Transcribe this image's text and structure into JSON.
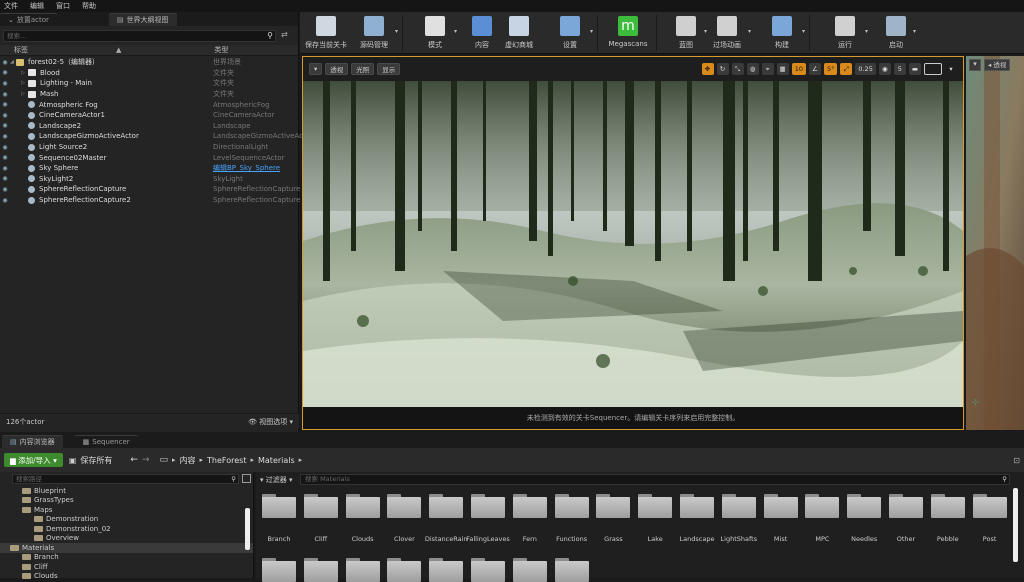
{
  "menu": [
    "文件",
    "编辑",
    "窗口",
    "帮助"
  ],
  "outliner": {
    "tab_place": "放置actor",
    "tab_outliner": "世界大纲视图",
    "search_placeholder": "搜索...",
    "col_label": "标签",
    "col_type": "类型",
    "rows": [
      {
        "label": "forest02-5（编辑器）",
        "type": "世界场景",
        "level": 0,
        "kind": "world"
      },
      {
        "label": "Blood",
        "type": "文件夹",
        "level": 1,
        "kind": "folder"
      },
      {
        "label": "Lighting - Main",
        "type": "文件夹",
        "level": 1,
        "kind": "folder"
      },
      {
        "label": "Mash",
        "type": "文件夹",
        "level": 1,
        "kind": "folder"
      },
      {
        "label": "Atmospheric Fog",
        "type": "AtmosphericFog",
        "level": 1,
        "kind": "actor"
      },
      {
        "label": "CineCameraActor1",
        "type": "CineCameraActor",
        "level": 1,
        "kind": "actor"
      },
      {
        "label": "Landscape2",
        "type": "Landscape",
        "level": 1,
        "kind": "actor"
      },
      {
        "label": "LandscapeGizmoActiveActor",
        "type": "LandscapeGizmoActiveAc",
        "level": 1,
        "kind": "actor"
      },
      {
        "label": "Light Source2",
        "type": "DirectionalLight",
        "level": 1,
        "kind": "actor"
      },
      {
        "label": "Sequence02Master",
        "type": "LevelSequenceActor",
        "level": 1,
        "kind": "actor"
      },
      {
        "label": "Sky Sphere",
        "type": "编辑BP_Sky_Sphere",
        "level": 1,
        "kind": "actor",
        "link": true
      },
      {
        "label": "SkyLight2",
        "type": "SkyLight",
        "level": 1,
        "kind": "actor"
      },
      {
        "label": "SphereReflectionCapture",
        "type": "SphereReflectionCapture",
        "level": 1,
        "kind": "actor"
      },
      {
        "label": "SphereReflectionCapture2",
        "type": "SphereReflectionCapture",
        "level": 1,
        "kind": "actor"
      }
    ],
    "count": "126个actor",
    "view_options": "视图选项"
  },
  "toolbar": [
    {
      "label": "保存当前关卡",
      "icon": "save-icon",
      "color": "#cfd8e0"
    },
    {
      "label": "源码管理",
      "icon": "source-control-icon",
      "color": "#8fb0d0"
    },
    {
      "label": "模式",
      "icon": "modes-icon",
      "color": "#e0e0e0"
    },
    {
      "label": "内容",
      "icon": "content-icon",
      "color": "#5a8fd6"
    },
    {
      "label": "虚幻商城",
      "icon": "marketplace-icon",
      "color": "#c7d4e4"
    },
    {
      "label": "设置",
      "icon": "settings-icon",
      "color": "#7aa6d8"
    },
    {
      "label": "Megascans",
      "icon": "megascans-icon",
      "color": "#3dbb3d"
    },
    {
      "label": "蓝图",
      "icon": "blueprint-icon",
      "color": "#cfcfcf"
    },
    {
      "label": "过场动画",
      "icon": "cinematics-icon",
      "color": "#d0d0d0"
    },
    {
      "label": "构建",
      "icon": "build-icon",
      "color": "#7aa6d8"
    },
    {
      "label": "运行",
      "icon": "play-icon",
      "color": "#d0d0d0"
    },
    {
      "label": "启动",
      "icon": "launch-icon",
      "color": "#a0b4c8"
    }
  ],
  "viewport": {
    "btn_perspective": "透视",
    "btn_lit": "光照",
    "btn_show": "显示",
    "snap_grid": "10",
    "snap_rotate": "5°",
    "snap_scale": "0.25",
    "camera_speed": "5",
    "message": "未检测到有效的关卡Sequencer。请编辑关卡序列来启用完整控制。",
    "right_persp": "透视"
  },
  "content_browser": {
    "tab_content": "内容浏览器",
    "tab_sequencer": "Sequencer",
    "add_import": "添加/导入",
    "save_all": "保存所有",
    "breadcrumb": [
      "内容",
      "TheForest",
      "Materials"
    ],
    "search_paths_placeholder": "搜索路径",
    "filters": "过滤器",
    "search_placeholder": "搜索 Materials",
    "tree": [
      {
        "label": "Blueprint",
        "level": 1
      },
      {
        "label": "GrassTypes",
        "level": 1
      },
      {
        "label": "Maps",
        "level": 1
      },
      {
        "label": "Demonstration",
        "level": 2
      },
      {
        "label": "Demonstration_02",
        "level": 2
      },
      {
        "label": "Overview",
        "level": 2
      },
      {
        "label": "Materials",
        "level": 0,
        "selected": true
      },
      {
        "label": "Branch",
        "level": 1
      },
      {
        "label": "Cliff",
        "level": 1
      },
      {
        "label": "Clouds",
        "level": 1
      }
    ],
    "folders": [
      "Branch",
      "Cliff",
      "Clouds",
      "Clover",
      "DistanceRain",
      "FallingLeaves",
      "Fern",
      "Functions",
      "Grass",
      "Lake",
      "Landscape",
      "LightShafts",
      "Mist",
      "MPC",
      "Needles",
      "Other",
      "Pebble",
      "Post"
    ]
  }
}
